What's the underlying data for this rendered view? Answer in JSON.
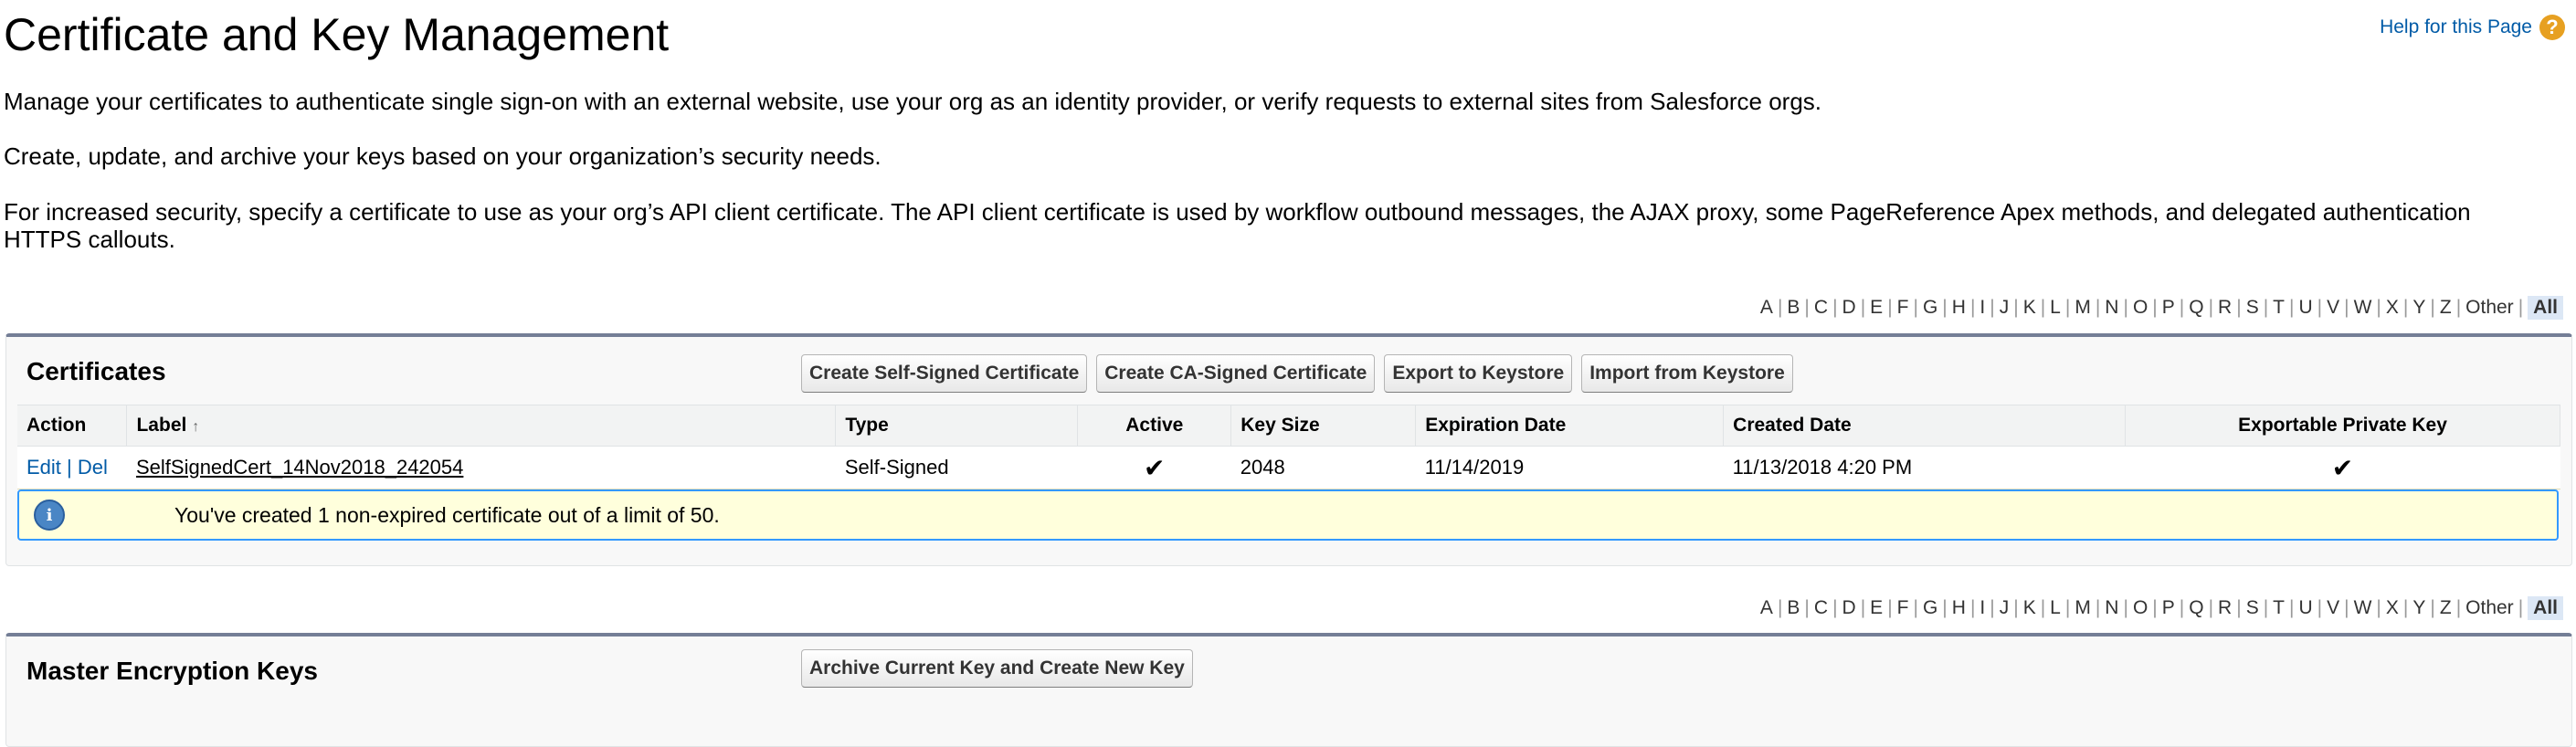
{
  "header": {
    "title": "Certificate and Key Management",
    "help_link": "Help for this Page",
    "help_icon": "?"
  },
  "intro": {
    "p1": "Manage your certificates to authenticate single sign-on with an external website, use your org as an identity provider, or verify requests to external sites from Salesforce orgs.",
    "p2": "Create, update, and archive your keys based on your organization’s security needs.",
    "p3": "For increased security, specify a certificate to use as your org’s API client certificate. The API client certificate is used by workflow outbound messages, the AJAX proxy, some PageReference Apex methods, and delegated authentication HTTPS callouts."
  },
  "alpha_filter": [
    "A",
    "B",
    "C",
    "D",
    "E",
    "F",
    "G",
    "H",
    "I",
    "J",
    "K",
    "L",
    "M",
    "N",
    "O",
    "P",
    "Q",
    "R",
    "S",
    "T",
    "U",
    "V",
    "W",
    "X",
    "Y",
    "Z",
    "Other",
    "All"
  ],
  "alpha_selected": "All",
  "certificates": {
    "title": "Certificates",
    "buttons": {
      "self_signed": "Create Self-Signed Certificate",
      "ca_signed": "Create CA-Signed Certificate",
      "export": "Export to Keystore",
      "import": "Import from Keystore"
    },
    "columns": {
      "action": "Action",
      "label": "Label",
      "sort_indicator": "↑",
      "type": "Type",
      "active": "Active",
      "key_size": "Key Size",
      "expiration": "Expiration Date",
      "created": "Created Date",
      "exportable": "Exportable Private Key"
    },
    "rows": [
      {
        "edit": "Edit",
        "sep": "|",
        "del": "Del",
        "label": "SelfSignedCert_14Nov2018_242054",
        "type": "Self-Signed",
        "active": "✔",
        "key_size": "2048",
        "expiration": "11/14/2019",
        "created": "11/13/2018 4:20 PM",
        "exportable": "✔"
      }
    ],
    "info_icon": "i",
    "info_text": "You've created 1 non-expired certificate out of a limit of 50."
  },
  "master_keys": {
    "title": "Master Encryption Keys",
    "button": "Archive Current Key and Create New Key"
  },
  "colors": {
    "link": "#015ba7",
    "panel_border": "#747e96",
    "info_bg": "#ffffdc",
    "info_border": "#3399ff",
    "help_icon": "#e7a021"
  }
}
